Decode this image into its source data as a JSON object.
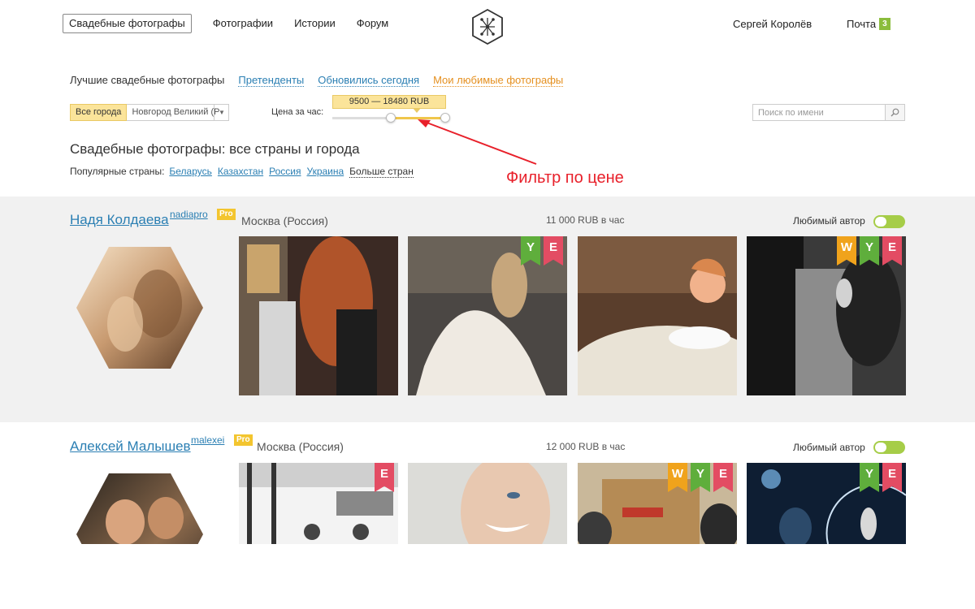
{
  "nav": {
    "items": [
      "Свадебные фотографы",
      "Фотографии",
      "Истории",
      "Форум"
    ],
    "user_name": "Сергей Королёв",
    "mail_label": "Почта",
    "mail_count": "3"
  },
  "tabs": {
    "current": "Лучшие свадебные фотографы",
    "contenders": "Претенденты",
    "updated_today": "Обновились сегодня",
    "favorites": "Мои любимые фотографы"
  },
  "filters": {
    "all_cities": "Все города",
    "city_selected": "Новгород Великий (Р",
    "price_label": "Цена за час:",
    "price_range": "9500 — 18480 RUB",
    "price_min": 9500,
    "price_max": 18480,
    "search_placeholder": "Поиск по имени"
  },
  "page": {
    "title": "Свадебные фотографы: все страны и города",
    "popular_label": "Популярные страны:",
    "countries": [
      "Беларусь",
      "Казахстан",
      "Россия",
      "Украина"
    ],
    "more_countries": "Больше стран"
  },
  "annotation": {
    "text": "Фильтр по цене",
    "color": "#e8202a"
  },
  "photographers": [
    {
      "name": "Надя Колдаева",
      "nick": "nadiapro",
      "badge": "Pro",
      "city": "Москва (Россия)",
      "rate": "11 000 RUB в час",
      "fav_label": "Любимый автор",
      "photos": [
        {
          "ribbons": []
        },
        {
          "ribbons": [
            "Y",
            "E"
          ]
        },
        {
          "ribbons": []
        },
        {
          "ribbons": [
            "W",
            "Y",
            "E"
          ]
        }
      ]
    },
    {
      "name": "Алексей Малышев",
      "nick": "malexei",
      "badge": "Pro",
      "city": "Москва (Россия)",
      "rate": "12 000 RUB в час",
      "fav_label": "Любимый автор",
      "photos": [
        {
          "ribbons": [
            "E"
          ]
        },
        {
          "ribbons": []
        },
        {
          "ribbons": [
            "W",
            "Y",
            "E"
          ]
        },
        {
          "ribbons": [
            "Y",
            "E"
          ]
        }
      ]
    }
  ],
  "colors": {
    "link": "#2b7fb3",
    "accent_orange": "#e59020",
    "pro_badge": "#f3c52f",
    "toggle_on": "#a6cd48",
    "ribbon_w": "#f0a31c",
    "ribbon_y": "#5fae3c",
    "ribbon_e": "#e34c63"
  }
}
